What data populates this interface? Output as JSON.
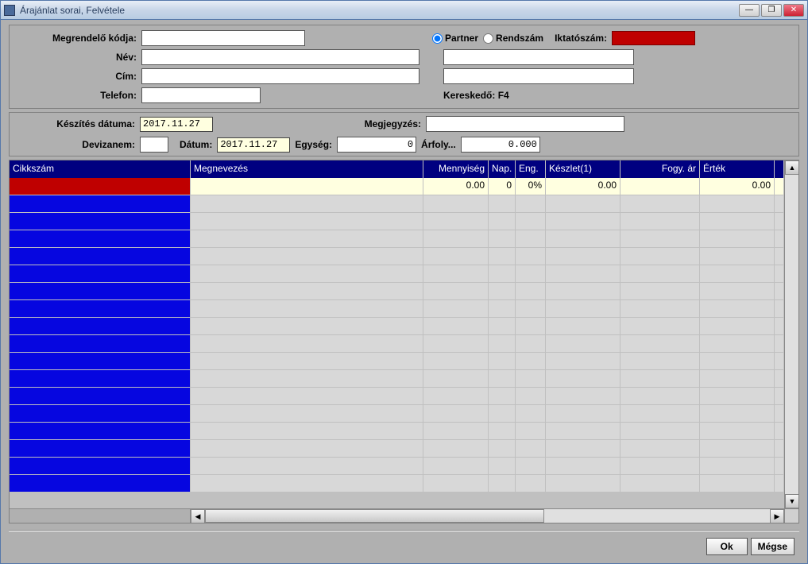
{
  "title": "Árajánlat sorai,   Felvétele",
  "form": {
    "customer_code_label": "Megrendelő kódja:",
    "customer_code": "",
    "name_label": "Név:",
    "name_left": "",
    "name_right": "",
    "address_label": "Cím:",
    "address_left": "",
    "address_right": "",
    "phone_label": "Telefon:",
    "phone": "",
    "merchant_label": "Kereskedő: F4",
    "partner_radio": "Partner",
    "rendszam_radio": "Rendszám",
    "iktatoszam_label": "Iktatószám:"
  },
  "meta": {
    "created_label": "Készítés dátuma:",
    "created": "2017.11.27",
    "note_label": "Megjegyzés:",
    "note": "",
    "currency_label": "Devizanem:",
    "currency": "",
    "date_label": "Dátum:",
    "date": "2017.11.27",
    "unit_label": "Egység:",
    "unit": "0",
    "rate_label": "Árfoly...",
    "rate": "0.000"
  },
  "grid": {
    "headers": {
      "id": "Cikkszám",
      "name": "Megnevezés",
      "qty": "Mennyiség",
      "day": "Nap.",
      "disc": "Eng.",
      "stock": "Készlet(1)",
      "price": "Fogy. ár",
      "value": "Érték"
    },
    "first_row": {
      "id": "",
      "name": "",
      "qty": "0.00",
      "day": "0",
      "disc": "0%",
      "stock": "0.00",
      "price": "",
      "value": "0.00"
    },
    "empty_rows": 17
  },
  "buttons": {
    "ok": "Ok",
    "cancel": "Mégse"
  },
  "window_controls": {
    "min": "—",
    "max": "❐",
    "close": "✕"
  }
}
